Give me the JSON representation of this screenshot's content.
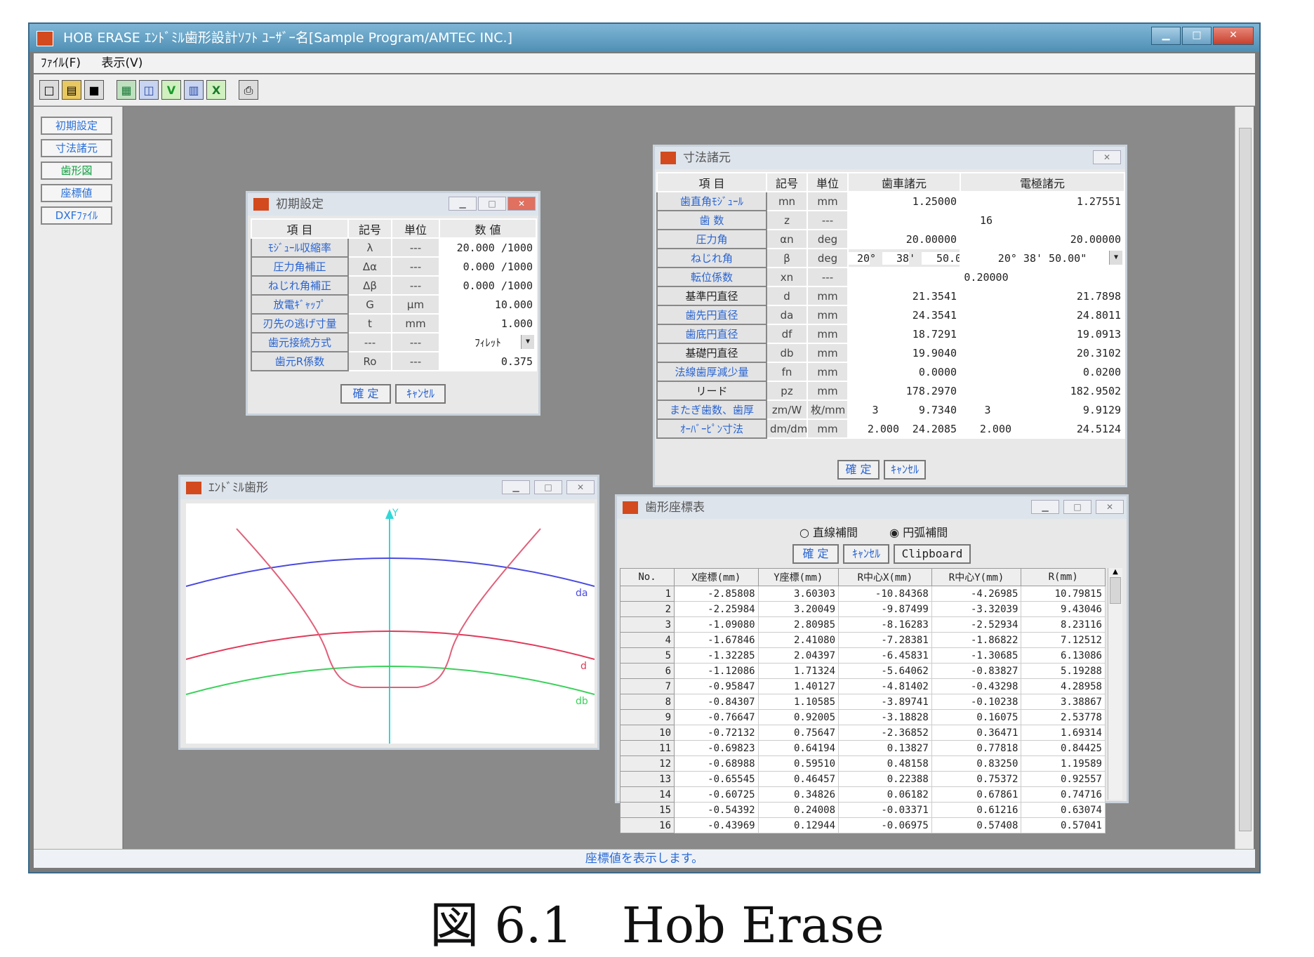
{
  "app": {
    "title": "HOB ERASE  ｴﾝﾄﾞﾐﾙ歯形設計ｿﾌﾄ  ﾕｰｻﾞｰ名[Sample Program/AMTEC INC.]",
    "menu": [
      "ﾌｧｲﾙ(F)",
      "表示(V)"
    ],
    "toolbar_icons": [
      "new-file-icon",
      "open-folder-icon",
      "save-icon",
      "chart-icon",
      "graph-icon",
      "v-icon",
      "table-icon",
      "export-icon",
      "print-icon"
    ],
    "side_buttons": [
      "初期設定",
      "寸法諸元",
      "歯形図",
      "座標値",
      "DXFﾌｧｲﾙ"
    ],
    "status": "座標値を表示します。"
  },
  "initial_window": {
    "title": "初期設定",
    "headers": [
      "項 目",
      "記号",
      "単位",
      "数 値"
    ],
    "rows": [
      {
        "label": "ﾓｼﾞｭｰﾙ収縮率",
        "sym": "λ",
        "unit": "---",
        "value": "20.000 /1000"
      },
      {
        "label": "圧力角補正",
        "sym": "Δα",
        "unit": "---",
        "value": "0.000 /1000"
      },
      {
        "label": "ねじれ角補正",
        "sym": "Δβ",
        "unit": "---",
        "value": "0.000 /1000"
      },
      {
        "label": "放電ｷﾞｬｯﾌﾟ",
        "sym": "G",
        "unit": "μm",
        "value": "10.000"
      },
      {
        "label": "刃先の逃げ寸量",
        "sym": "t",
        "unit": "mm",
        "value": "1.000"
      },
      {
        "label": "歯元接続方式",
        "sym": "---",
        "unit": "---",
        "value": "ﾌｨﾚｯﾄ"
      },
      {
        "label": "歯元R係数",
        "sym": "Ro",
        "unit": "---",
        "value": "0.375"
      }
    ],
    "ok": "確 定",
    "cancel": "ｷｬﾝｾﾙ"
  },
  "dim_window": {
    "title": "寸法諸元",
    "headers": [
      "項 目",
      "記号",
      "単位",
      "歯車諸元",
      "電極諸元"
    ],
    "rows": [
      {
        "label": "歯直角ﾓｼﾞｭｰﾙ",
        "sym": "mn",
        "unit": "mm",
        "gear": "1.25000",
        "elec": "1.27551",
        "blue": true
      },
      {
        "label": "歯 数",
        "sym": "z",
        "unit": "---",
        "merged": "16",
        "blue": true
      },
      {
        "label": "圧力角",
        "sym": "αn",
        "unit": "deg",
        "gear": "20.00000",
        "elec": "20.00000",
        "blue": true
      },
      {
        "label": "ねじれ角",
        "sym": "β",
        "unit": "deg",
        "deg": "20",
        "min": "38",
        "sec": "50.00",
        "elec": "20° 38' 50.00\"",
        "blue": true
      },
      {
        "label": "転位係数",
        "sym": "xn",
        "unit": "---",
        "merged": "0.20000",
        "blue": true
      },
      {
        "label": "基準円直径",
        "sym": "d",
        "unit": "mm",
        "gear": "21.3541",
        "elec": "21.7898",
        "blue": false
      },
      {
        "label": "歯先円直径",
        "sym": "da",
        "unit": "mm",
        "gear": "24.3541",
        "elec": "24.8011",
        "blue": true
      },
      {
        "label": "歯底円直径",
        "sym": "df",
        "unit": "mm",
        "gear": "18.7291",
        "elec": "19.0913",
        "blue": true
      },
      {
        "label": "基礎円直径",
        "sym": "db",
        "unit": "mm",
        "gear": "19.9040",
        "elec": "20.3102",
        "blue": false
      },
      {
        "label": "法線歯厚減少量",
        "sym": "fn",
        "unit": "mm",
        "gear": "0.0000",
        "elec": "0.0200",
        "blue": true
      },
      {
        "label": "リード",
        "sym": "pz",
        "unit": "mm",
        "gear": "178.2970",
        "elec": "182.9502",
        "blue": false
      },
      {
        "label": "またぎ歯数、歯厚",
        "sym": "zm/W",
        "unit": "枚/mm",
        "g1": "3",
        "g2": "9.7340",
        "e1": "3",
        "e2": "9.9129",
        "blue": true
      },
      {
        "label": "ｵｰﾊﾞｰﾋﾟﾝ寸法",
        "sym": "dm/dm",
        "unit": "mm",
        "g1": "2.000",
        "g2": "24.2085",
        "e1": "2.000",
        "e2": "24.5124",
        "blue": true
      }
    ],
    "ok": "確 定",
    "cancel": "ｷｬﾝｾﾙ"
  },
  "profile_window": {
    "title": "ｴﾝﾄﾞﾐﾙ歯形",
    "axis_label": "Y",
    "curve_labels": {
      "da": "da",
      "d": "d",
      "db": "db"
    },
    "colors": {
      "da": "#4a4ae0",
      "d": "#e03a5a",
      "db": "#3ad05a",
      "axis": "#30d8d8",
      "tooth": "#e0607a"
    }
  },
  "coord_window": {
    "title": "歯形座標表",
    "radio_linear": "直線補間",
    "radio_arc": "円弧補間",
    "ok": "確 定",
    "cancel": "ｷｬﾝｾﾙ",
    "clipboard": "Clipboard",
    "headers": [
      "No.",
      "X座標(mm)",
      "Y座標(mm)",
      "R中心X(mm)",
      "R中心Y(mm)",
      "R(mm)"
    ],
    "rows": [
      [
        "1",
        "-2.85808",
        "3.60303",
        "-10.84368",
        "-4.26985",
        "10.79815"
      ],
      [
        "2",
        "-2.25984",
        "3.20049",
        "-9.87499",
        "-3.32039",
        "9.43046"
      ],
      [
        "3",
        "-1.09080",
        "2.80985",
        "-8.16283",
        "-2.52934",
        "8.23116"
      ],
      [
        "4",
        "-1.67846",
        "2.41080",
        "-7.28381",
        "-1.86822",
        "7.12512"
      ],
      [
        "5",
        "-1.32285",
        "2.04397",
        "-6.45831",
        "-1.30685",
        "6.13086"
      ],
      [
        "6",
        "-1.12086",
        "1.71324",
        "-5.64062",
        "-0.83827",
        "5.19288"
      ],
      [
        "7",
        "-0.95847",
        "1.40127",
        "-4.81402",
        "-0.43298",
        "4.28958"
      ],
      [
        "8",
        "-0.84307",
        "1.10585",
        "-3.89741",
        "-0.10238",
        "3.38867"
      ],
      [
        "9",
        "-0.76647",
        "0.92005",
        "-3.18828",
        "0.16075",
        "2.53778"
      ],
      [
        "10",
        "-0.72132",
        "0.75647",
        "-2.36852",
        "0.36471",
        "1.69314"
      ],
      [
        "11",
        "-0.69823",
        "0.64194",
        "0.13827",
        "0.77818",
        "0.84425"
      ],
      [
        "12",
        "-0.68988",
        "0.59510",
        "0.48158",
        "0.83250",
        "1.19589"
      ],
      [
        "13",
        "-0.65545",
        "0.46457",
        "0.22388",
        "0.75372",
        "0.92557"
      ],
      [
        "14",
        "-0.60725",
        "0.34826",
        "0.06182",
        "0.67861",
        "0.74716"
      ],
      [
        "15",
        "-0.54392",
        "0.24008",
        "-0.03371",
        "0.61216",
        "0.63074"
      ],
      [
        "16",
        "-0.43969",
        "0.12944",
        "-0.06975",
        "0.57408",
        "0.57041"
      ]
    ]
  },
  "caption": "図 6.1　Hob Erase"
}
